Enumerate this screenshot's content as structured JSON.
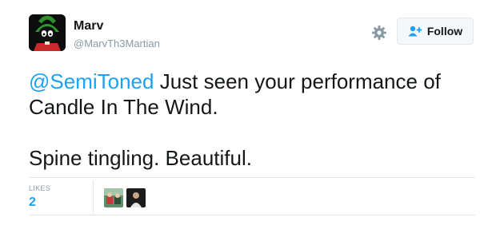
{
  "tweet": {
    "author_name": "Marv",
    "author_handle": "@MarvTh3Martian",
    "follow_label": "Follow",
    "mention": "@SemiToned",
    "line1_rest": " Just seen your performance of",
    "line2": "Candle In The Wind.",
    "line3": "Spine tingling. Beautiful."
  },
  "stats": {
    "likes_label": "LIKES",
    "likes_count": "2"
  },
  "icons": {
    "settings": "gear-icon",
    "follow": "add-user-icon"
  },
  "colors": {
    "link": "#1da1f2",
    "muted": "#8899a6",
    "text": "#14171a",
    "border": "#e1e8ed"
  }
}
